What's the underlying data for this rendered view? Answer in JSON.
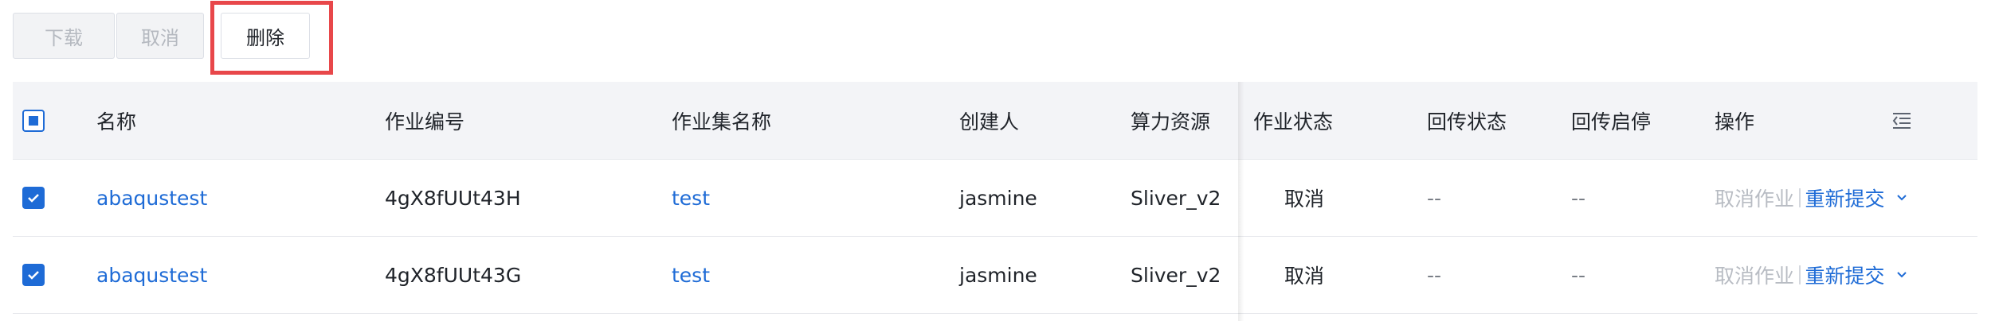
{
  "toolbar": {
    "download_label": "下载",
    "cancel_label": "取消",
    "delete_label": "删除"
  },
  "table": {
    "headers": {
      "name": "名称",
      "job_id": "作业编号",
      "jobset": "作业集名称",
      "creator": "创建人",
      "resource": "算力资源",
      "status": "作业状态",
      "return_status": "回传状态",
      "return_enable": "回传启停",
      "actions": "操作"
    },
    "rows": [
      {
        "checked": true,
        "name": "abaqustest",
        "job_id": "4gX8fUUt43H",
        "jobset": "test",
        "creator": "jasmine",
        "resource": "Sliver_v2",
        "status": "取消",
        "return_status": "--",
        "return_enable": "--",
        "action_cancel": "取消作业",
        "action_resubmit": "重新提交"
      },
      {
        "checked": true,
        "name": "abaqustest",
        "job_id": "4gX8fUUt43G",
        "jobset": "test",
        "creator": "jasmine",
        "resource": "Sliver_v2",
        "status": "取消",
        "return_status": "--",
        "return_enable": "--",
        "action_cancel": "取消作业",
        "action_resubmit": "重新提交"
      }
    ]
  },
  "icons": {
    "column_settings": "column-settings-icon",
    "chevron": "chevron-down-icon",
    "checkbox_checked": "check-icon"
  },
  "colors": {
    "primary": "#1e6bd6",
    "highlight": "#e8474a",
    "header_bg": "#f3f4f7",
    "disabled_text": "#b5b9c0"
  }
}
